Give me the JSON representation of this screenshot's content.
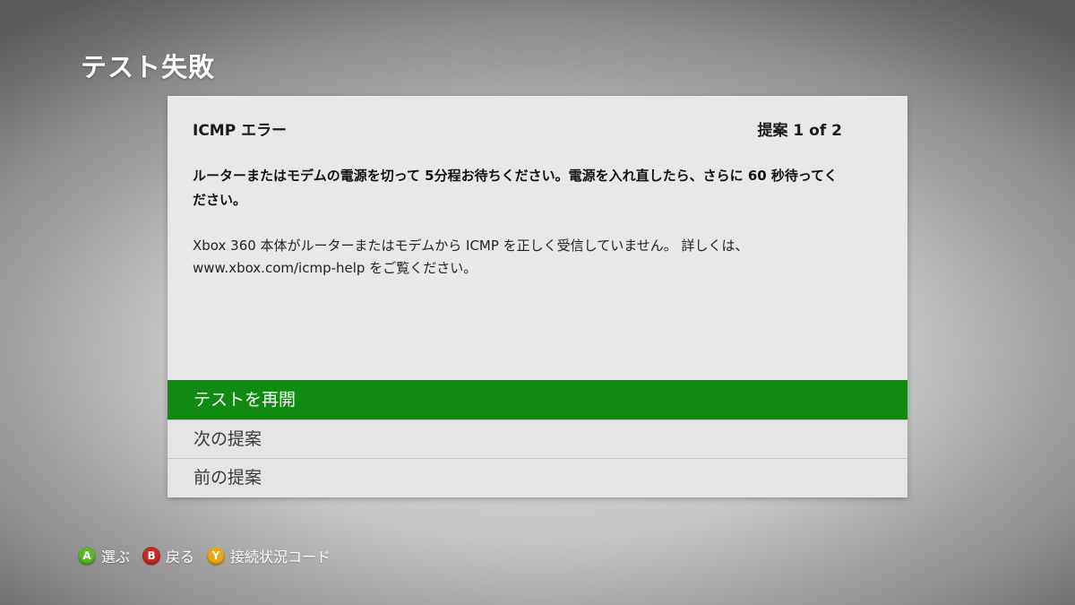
{
  "page": {
    "title": "テスト失敗"
  },
  "dialog": {
    "error_title": "ICMP エラー",
    "suggestion_counter": "提案 1 of 2",
    "suggestion": "ルーターまたはモデムの電源を切って 5分程お待ちください。電源を入れ直したら、さらに 60 秒待ってください。",
    "detail": "Xbox 360 本体がルーターまたはモデムから ICMP を正しく受信していません。 詳しくは、www.xbox.com/icmp-help をご覧ください。"
  },
  "options": [
    {
      "label": "テストを再開",
      "selected": true
    },
    {
      "label": "次の提案",
      "selected": false
    },
    {
      "label": "前の提案",
      "selected": false
    }
  ],
  "footer": {
    "hints": [
      {
        "button": "A",
        "label": "選ぶ",
        "color": "#5cb32d"
      },
      {
        "button": "B",
        "label": "戻る",
        "color": "#c22a25"
      },
      {
        "button": "Y",
        "label": "接続状況コード",
        "color": "#e7a81c"
      }
    ]
  }
}
